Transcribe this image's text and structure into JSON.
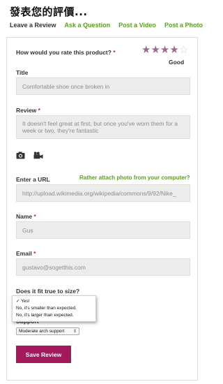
{
  "page": {
    "title": "發表您的評價..."
  },
  "tabs": [
    {
      "label": "Leave a Review",
      "active": true
    },
    {
      "label": "Ask a Question"
    },
    {
      "label": "Post a Video"
    },
    {
      "label": "Post a Photo"
    }
  ],
  "rating": {
    "question": "How would you rate this product?",
    "required_mark": "*",
    "value": 4,
    "max": 5,
    "text": "Good",
    "star_color": "#9d6b8f"
  },
  "title_field": {
    "label": "Title",
    "placeholder": "Comfortable shoe once broken in"
  },
  "review_field": {
    "label": "Review",
    "required_mark": "*",
    "placeholder": "It doesn't feel great at first, but once you've worn them for a week or two, they're fantastic"
  },
  "media": {
    "icons": [
      "camera-icon",
      "video-camera-icon"
    ]
  },
  "url_field": {
    "label": "Enter a URL",
    "photo_link": "Rather attach photo from your computer?",
    "placeholder": "http://upload.wikimedia.org/wikipedia/commons/9/92/Nike_"
  },
  "name_field": {
    "label": "Name",
    "required_mark": "*",
    "placeholder": "Gus"
  },
  "email_field": {
    "label": "Email",
    "required_mark": "*",
    "placeholder": "gustavo@sogetthis.com"
  },
  "fit": {
    "question": "Does it fit true to size?",
    "options": [
      "✓ Yes!",
      "No, it's smaller than expected.",
      "No, it's larger than expected."
    ]
  },
  "support": {
    "label": "Support",
    "selected": "Moderate arch support"
  },
  "save_button": {
    "label": "Save Review",
    "color": "#a3195b"
  },
  "colors": {
    "accent_green": "#5aa01e",
    "required_red": "#cc1f1f"
  }
}
